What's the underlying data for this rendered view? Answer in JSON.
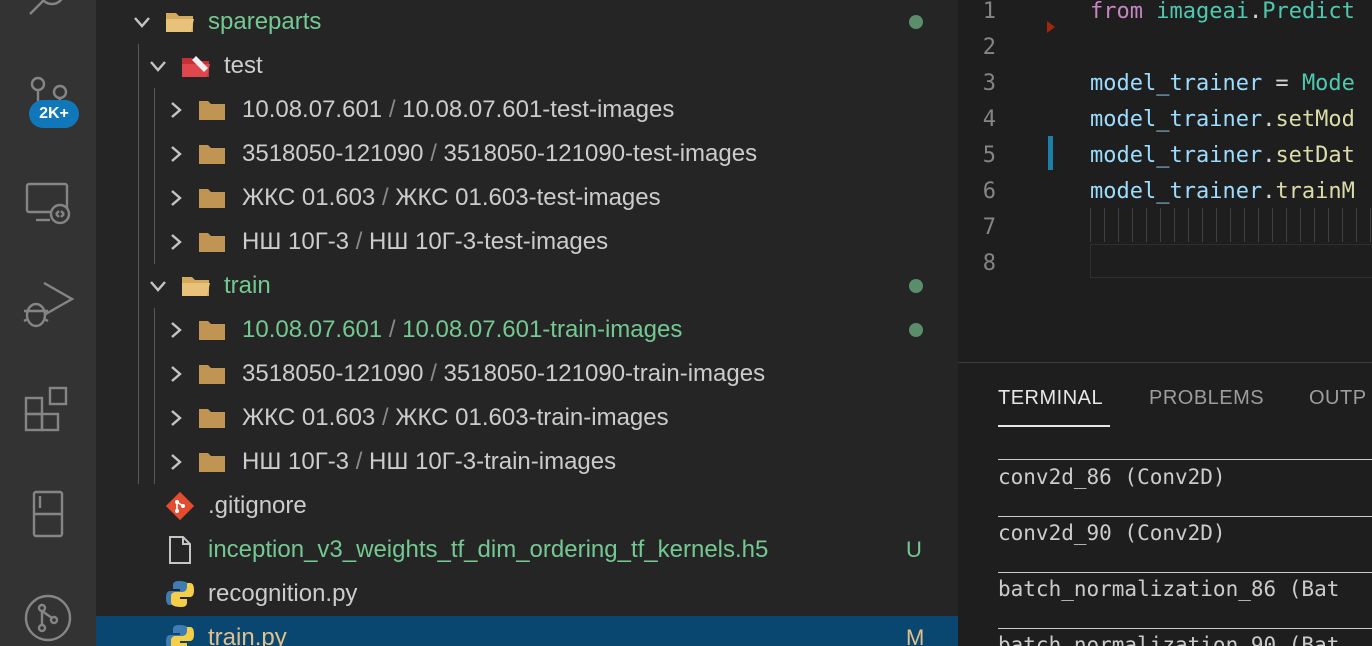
{
  "activity_bar": {
    "badge": "2K+"
  },
  "explorer": {
    "items": [
      {
        "label": "spareparts",
        "modified": true
      },
      {
        "label": "test"
      },
      {
        "a": "10.08.07.601",
        "sep": "/",
        "b": "10.08.07.601-test-images"
      },
      {
        "a": "3518050-121090",
        "sep": "/",
        "b": "3518050-121090-test-images"
      },
      {
        "a": "ЖКС 01.603",
        "sep": "/",
        "b": "ЖКС 01.603-test-images"
      },
      {
        "a": "НШ 10Г-3",
        "sep": "/",
        "b": "НШ 10Г-3-test-images"
      },
      {
        "label": "train",
        "modified": true
      },
      {
        "a": "10.08.07.601",
        "sep": "/",
        "b": "10.08.07.601-train-images",
        "modified": true
      },
      {
        "a": "3518050-121090",
        "sep": "/",
        "b": "3518050-121090-train-images"
      },
      {
        "a": "ЖКС 01.603",
        "sep": "/",
        "b": "ЖКС 01.603-train-images"
      },
      {
        "a": "НШ 10Г-3",
        "sep": "/",
        "b": "НШ 10Г-3-train-images"
      },
      {
        "label": ".gitignore"
      },
      {
        "label": "inception_v3_weights_tf_dim_ordering_tf_kernels.h5",
        "status": "U"
      },
      {
        "label": "recognition.py"
      },
      {
        "label": "train.py",
        "status": "M",
        "selected": true
      }
    ]
  },
  "editor": {
    "lines": [
      {
        "n": "1",
        "parts": [
          [
            "kw",
            "from"
          ],
          [
            "pl",
            " "
          ],
          [
            "id",
            "imageai"
          ],
          [
            "pl",
            "."
          ],
          [
            "id",
            "Predict"
          ]
        ]
      },
      {
        "n": "2",
        "parts": []
      },
      {
        "n": "3",
        "parts": [
          [
            "var",
            "model_trainer"
          ],
          [
            "pl",
            " = "
          ],
          [
            "id",
            "Mode"
          ]
        ]
      },
      {
        "n": "4",
        "parts": [
          [
            "var",
            "model_trainer"
          ],
          [
            "pl",
            "."
          ],
          [
            "fn",
            "setMod"
          ]
        ]
      },
      {
        "n": "5",
        "parts": [
          [
            "var",
            "model_trainer"
          ],
          [
            "pl",
            "."
          ],
          [
            "fn",
            "setDat"
          ]
        ]
      },
      {
        "n": "6",
        "parts": [
          [
            "var",
            "model_trainer"
          ],
          [
            "pl",
            "."
          ],
          [
            "fn",
            "trainM"
          ]
        ]
      },
      {
        "n": "7",
        "parts": []
      },
      {
        "n": "8",
        "parts": []
      }
    ]
  },
  "panel": {
    "tabs": [
      "TERMINAL",
      "PROBLEMS",
      "OUTP"
    ],
    "active_tab": "TERMINAL",
    "terminal_lines": [
      "conv2d_86 (Conv2D)",
      "conv2d_90 (Conv2D)",
      "batch_normalization_86 (Bat",
      "batch_normalization_90 (Bat"
    ]
  },
  "colors": {
    "accent": "#1177bb",
    "selection": "#094771",
    "git_modified_green": "#73c991",
    "activity_bar": "#333333",
    "sidebar": "#252526",
    "editor_bg": "#1e1e1e"
  }
}
